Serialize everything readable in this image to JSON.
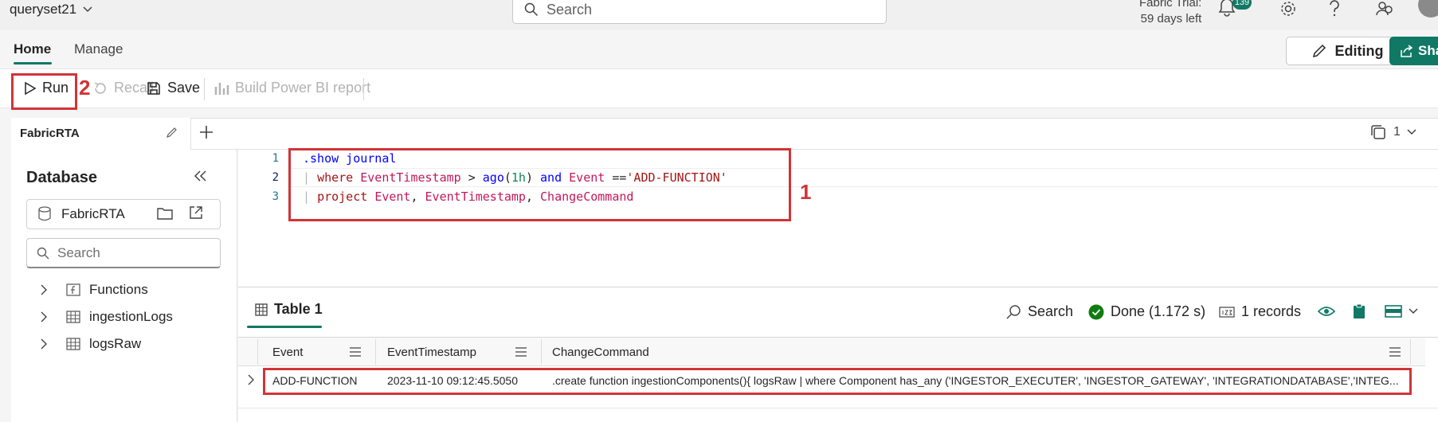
{
  "top": {
    "app_title": "queryset21",
    "search_placeholder": "Search",
    "trial_line1": "Fabric Trial:",
    "trial_line2": "59 days left",
    "notifications_count": "139"
  },
  "ribbon": {
    "tab_home": "Home",
    "tab_manage": "Manage",
    "editing_label": "Editing",
    "share_label": "Sha"
  },
  "toolbar": {
    "run_label": "Run",
    "recall_label": "Recall",
    "save_label": "Save",
    "build_report_label": "Build Power BI report",
    "callout_run": "2"
  },
  "query_tabs": {
    "active_tab": "FabricRTA",
    "count": "1"
  },
  "database_pane": {
    "title": "Database",
    "selected_database": "FabricRTA",
    "search_placeholder": "Search",
    "tree": [
      {
        "label": "Functions",
        "icon": "function-icon"
      },
      {
        "label": "ingestionLogs",
        "icon": "table-icon"
      },
      {
        "label": "logsRaw",
        "icon": "table-icon"
      }
    ]
  },
  "editor": {
    "line_numbers": [
      "1",
      "2",
      "3"
    ],
    "callout_code": "1",
    "line1": {
      "cmd": ".show journal"
    },
    "line2": {
      "pipe": "|",
      "kw_where": "where",
      "field": "EventTimestamp",
      "op": ">",
      "fn": "ago",
      "open": "(",
      "num": "1h",
      "close": ")",
      "kw_and": "and",
      "field2": "Event",
      "eq": "==",
      "str": "'ADD-FUNCTION'"
    },
    "line3": {
      "pipe": "|",
      "kw_project": "project",
      "c1": "Event",
      "comma1": ",",
      "c2": "EventTimestamp",
      "comma2": ",",
      "c3": "ChangeCommand"
    }
  },
  "results": {
    "tab_label": "Table 1",
    "search_label": "Search",
    "status_label": "Done (1.172 s)",
    "records_label": "1 records",
    "columns": [
      "Event",
      "EventTimestamp",
      "ChangeCommand"
    ],
    "rows": [
      {
        "event": "ADD-FUNCTION",
        "timestamp": "2023-11-10 09:12:45.5050",
        "command": ".create function ingestionComponents(){ logsRaw | where Component has_any ('INGESTOR_EXECUTER', 'INGESTOR_GATEWAY', 'INTEGRATIONDATABASE','INTEG..."
      }
    ]
  },
  "colors": {
    "accent": "#117865",
    "highlight_box": "#d13438"
  }
}
